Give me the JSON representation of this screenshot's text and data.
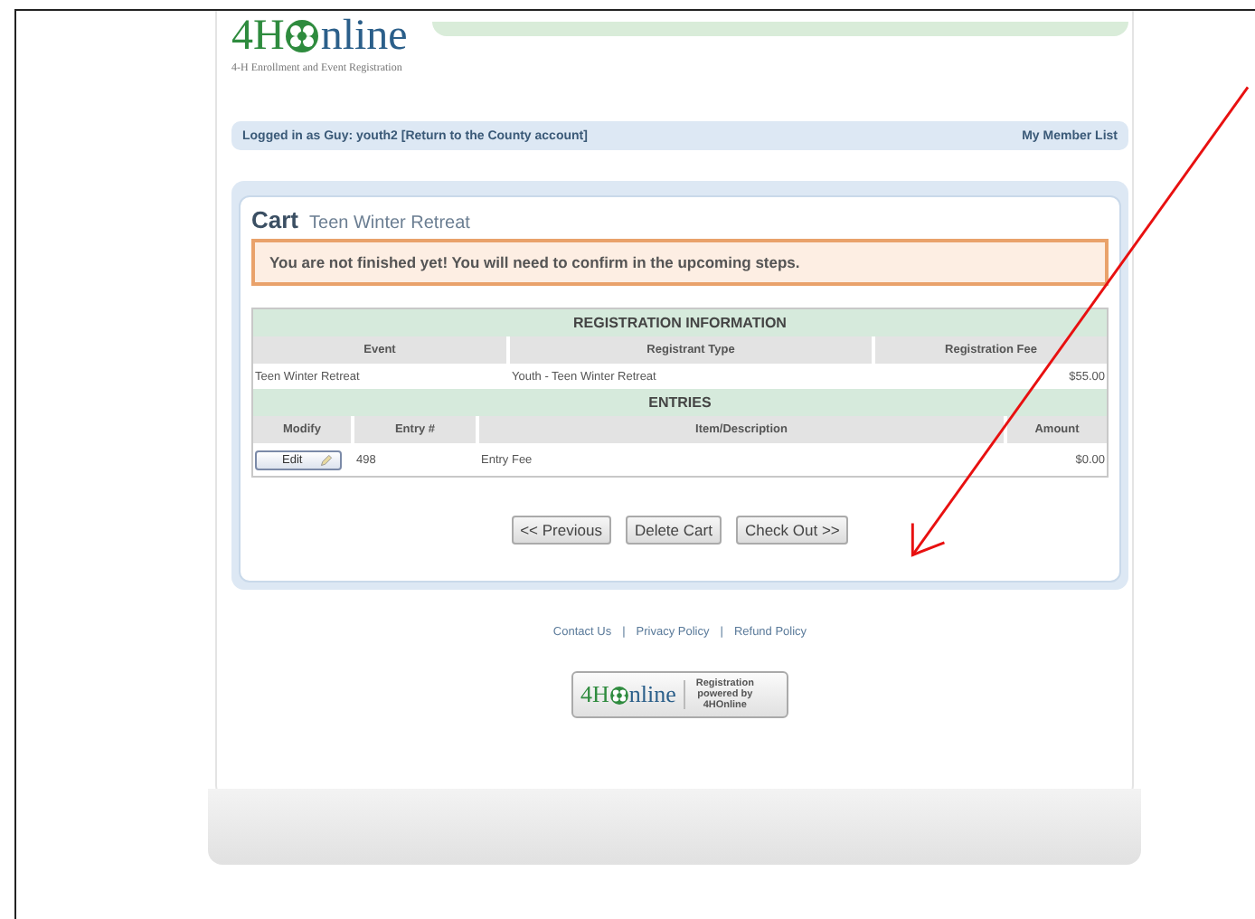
{
  "header": {
    "logo_left": "4H",
    "logo_right": "nline",
    "tagline": "4-H Enrollment and Event Registration"
  },
  "login_bar": {
    "status": "Logged in as Guy: youth2 [Return to the County account]",
    "link": "My Member List"
  },
  "cart": {
    "title": "Cart",
    "event": "Teen Winter Retreat",
    "notice": "You are not finished yet! You will need to confirm in the upcoming steps.",
    "registration": {
      "heading": "REGISTRATION INFORMATION",
      "columns": [
        "Event",
        "Registrant Type",
        "Registration Fee"
      ],
      "rows": [
        [
          "Teen Winter Retreat",
          "Youth - Teen Winter Retreat",
          "$55.00"
        ]
      ]
    },
    "entries": {
      "heading": "ENTRIES",
      "columns": [
        "Modify",
        "Entry #",
        "Item/Description",
        "Amount"
      ],
      "rows": [
        {
          "action": "Edit",
          "entry": "498",
          "description": "Entry Fee",
          "amount": "$0.00"
        }
      ]
    },
    "buttons": [
      "<< Previous",
      "Delete Cart",
      "Check Out >>"
    ]
  },
  "footer": {
    "links": [
      "Contact Us",
      "Privacy Policy",
      "Refund Policy"
    ],
    "separator": "|",
    "badge": {
      "logo_left": "4H",
      "logo_right": "nline",
      "caption": "Registration powered by 4HOnline"
    }
  }
}
